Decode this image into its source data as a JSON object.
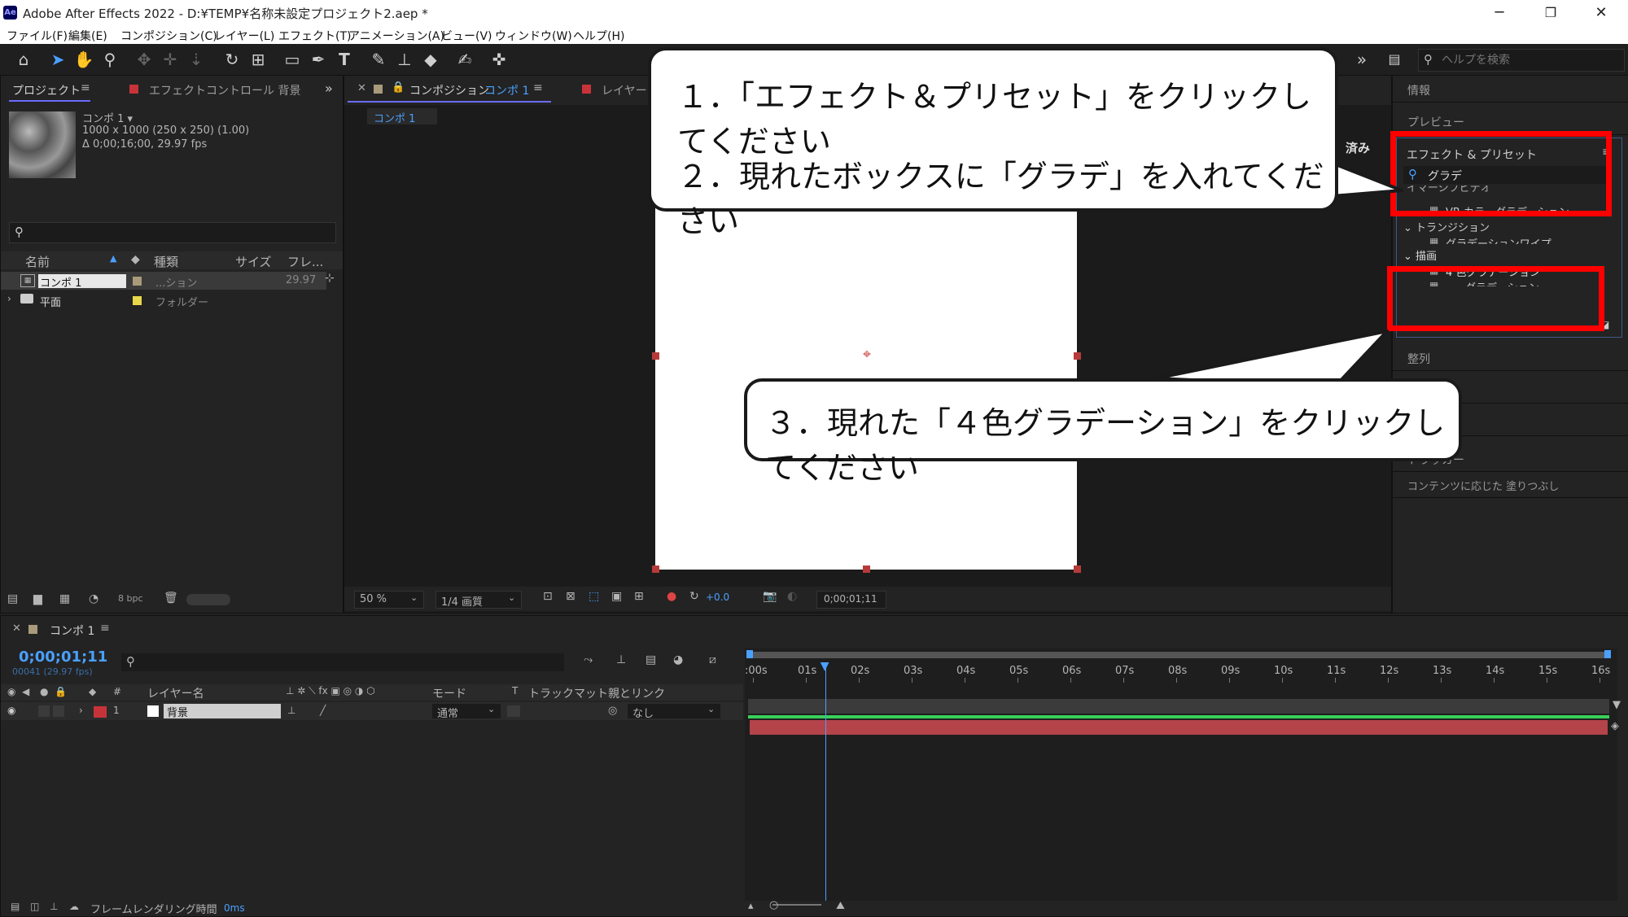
{
  "window": {
    "title": "Adobe After Effects 2022 - D:¥TEMP¥名称未設定プロジェクト2.aep *",
    "logo": "Ae"
  },
  "menu": [
    "ファイル(F)",
    "編集(E)",
    "コンポジション(C)",
    "レイヤー(L)",
    "エフェクト(T)",
    "アニメーション(A)",
    "ビュー(V)",
    "ウィンドウ(W)",
    "ヘルプ(H)"
  ],
  "toolbar": {
    "help_search_placeholder": "ヘルプを検索"
  },
  "project_panel": {
    "tab_project": "プロジェクト",
    "tab_effect_controls": "エフェクトコントロール 背景",
    "item_name": "コンポ 1 ▾",
    "item_dims": "1000 x 1000  (250 x 250) (1.00)",
    "item_duration": "Δ 0;00;16;00, 29.97 fps",
    "search_placeholder": "",
    "columns": [
      "名前",
      "種類",
      "サイズ",
      "フレ..."
    ],
    "rows": [
      {
        "name": "コンポ 1",
        "type": "...ション",
        "fps": "29.97",
        "color": "#a89a7a"
      },
      {
        "name": "平面",
        "type": "フォルダー",
        "fps": "",
        "color": "#e6d84a"
      }
    ],
    "footer_bpc": "8 bpc"
  },
  "comp_panel": {
    "tab_label": "コンポジション",
    "tab_comp_name": "コンポ 1",
    "tab_layer": "レイヤー",
    "breadcrumb": "コンポ 1",
    "zoom": "50 %",
    "quality": "1/4 画質",
    "exposure": "+0.0",
    "timecode": "0;00;01;11",
    "hidden_label": "済み"
  },
  "right_panel": {
    "info": "情報",
    "preview": "プレビュー",
    "effects_presets": "エフェクト & プリセット",
    "search_value": "グラデ",
    "cut_category": "イマーシブビデオ",
    "items": [
      {
        "label": "VR カラーグラデーション",
        "type": "effect"
      },
      {
        "label": "トランジション",
        "type": "category"
      },
      {
        "label": "グラデーションワイプ",
        "type": "effect"
      },
      {
        "label": "描画",
        "type": "category"
      },
      {
        "label": "4 色グラデーション",
        "type": "effect"
      },
      {
        "label": "グラデーション",
        "type": "effect"
      }
    ],
    "align": "整列",
    "tracker": "トラッカー",
    "content_aware_fill": "コンテンツに応じた 塗りつぶし"
  },
  "timeline": {
    "tab": "コンポ 1",
    "timecode": "0;00;01;11",
    "frame_info": "00041 (29.97 fps)",
    "columns": {
      "layer_name": "レイヤー名",
      "mode": "モード",
      "trkmat_t": "T",
      "track_matte": "トラックマット",
      "parent": "親とリンク"
    },
    "layer": {
      "index": "1",
      "name": "背景",
      "mode": "通常",
      "parent": "なし"
    },
    "ticks": [
      ":00s",
      "01s",
      "02s",
      "03s",
      "04s",
      "05s",
      "06s",
      "07s",
      "08s",
      "09s",
      "10s",
      "11s",
      "12s",
      "13s",
      "14s",
      "15s",
      "16s"
    ],
    "playhead_fraction": 0.0853,
    "footer_render_label": "フレームレンダリング時間",
    "footer_render_value": "0ms"
  },
  "callouts": {
    "c1": "１．「エフェクト＆プリセット」をクリックしてください",
    "c2": "２．現れたボックスに「グラデ」を入れてください",
    "c3": "３．現れた「４色グラデーション」をクリックしてください"
  },
  "colors": {
    "highlight_red": "#ff0000",
    "accent_blue": "#4aa0ff",
    "layer_bar": "#b4434a",
    "label_red": "#c8333a"
  }
}
